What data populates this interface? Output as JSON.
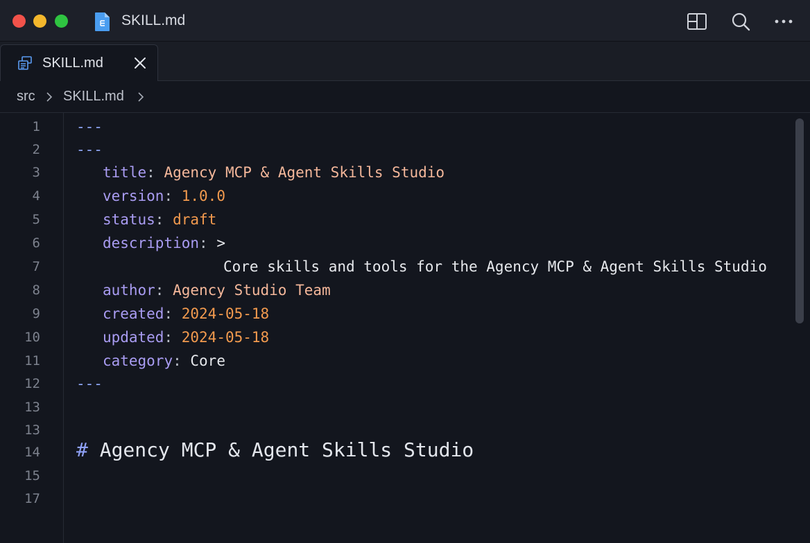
{
  "window": {
    "title": "SKILL.md",
    "icons": [
      "file-icon",
      "split-layout-icon",
      "search-icon",
      "more-icon"
    ]
  },
  "tabs": [
    {
      "label": "SKILL.md",
      "icon": "markdown-file-icon",
      "active": true
    }
  ],
  "breadcrumb": {
    "parts": [
      "src",
      "SKILL.md"
    ]
  },
  "editor": {
    "line_numbers": [
      "1",
      "2",
      "3",
      "4",
      "5",
      "6",
      "7",
      "8",
      "9",
      "10",
      "11",
      "12",
      "13",
      "13",
      "14",
      "15",
      "17"
    ],
    "lines": {
      "l1": "---",
      "l2": "---",
      "title_key": "title",
      "title_val": "Agency MCP & Agent Skills Studio",
      "version_key": "version",
      "version_val": "1.0.0",
      "status_key": "status",
      "status_val": "draft",
      "description_key": "description",
      "description_marker": ">",
      "description_text": "Core skills and tools for the Agency MCP & Agent Skills Studio",
      "author_key": "author",
      "author_val": "Agency Studio Team",
      "created_key": "created",
      "created_val": "2024-05-18",
      "updated_key": "updated",
      "updated_val": "2024-05-18",
      "category_key": "category",
      "category_val": "Core",
      "l12": "---",
      "heading_marker": "#",
      "heading_text": "Agency MCP & Agent Skills Studio"
    }
  },
  "colors": {
    "background": "#13161e",
    "titlebar": "#1d2029",
    "key": "#a99cf2",
    "string": "#f4b79a",
    "number": "#f29a4e",
    "heading_marker": "#8fa1f7"
  }
}
